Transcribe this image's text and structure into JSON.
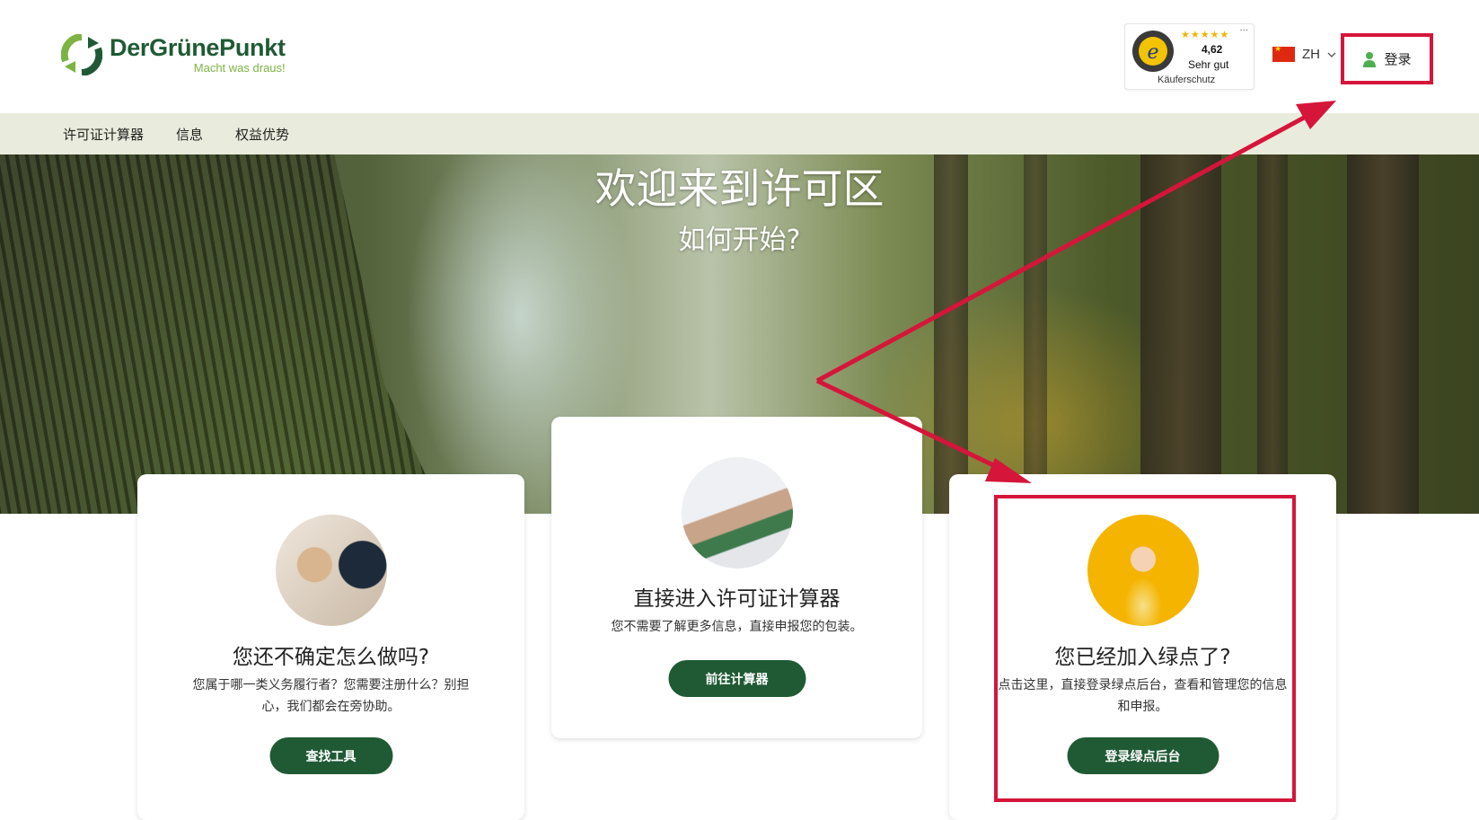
{
  "header": {
    "logo": {
      "name": "DerGrünePunkt",
      "tagline": "Macht was draus!"
    },
    "trust_badge": {
      "score": "4,62",
      "rating": "Sehr gut",
      "protection": "Käuferschutz",
      "stars": "★★★★★"
    },
    "language": {
      "code": "ZH"
    },
    "login_label": "登录"
  },
  "nav": {
    "items": [
      "许可证计算器",
      "信息",
      "权益优势"
    ]
  },
  "hero": {
    "title": "欢迎来到许可区",
    "subtitle": "如何开始?"
  },
  "cards": [
    {
      "title": "您还不确定怎么做吗?",
      "description": "您属于哪一类义务履行者？您需要注册什么？别担心，我们都会在旁协助。",
      "button": "查找工具"
    },
    {
      "title": "直接进入许可证计算器",
      "description": "您不需要了解更多信息，直接申报您的包装。",
      "button": "前往计算器"
    },
    {
      "title": "您已经加入绿点了?",
      "description": "点击这里，直接登录绿点后台，查看和管理您的信息和申报。",
      "button": "登录绿点后台"
    }
  ],
  "colors": {
    "brand_green": "#1f5a34",
    "accent_green": "#7cb342",
    "annotation_red": "#d6153a",
    "nav_bg": "#e9ecdc"
  }
}
